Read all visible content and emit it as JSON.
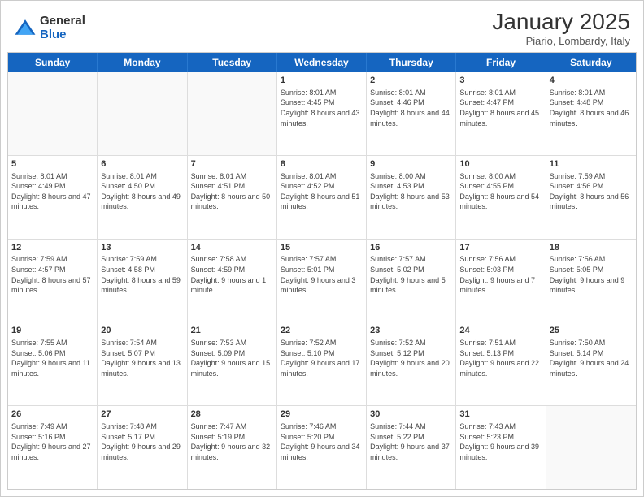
{
  "header": {
    "logo_general": "General",
    "logo_blue": "Blue",
    "month_title": "January 2025",
    "location": "Piario, Lombardy, Italy"
  },
  "day_headers": [
    "Sunday",
    "Monday",
    "Tuesday",
    "Wednesday",
    "Thursday",
    "Friday",
    "Saturday"
  ],
  "weeks": [
    [
      {
        "num": "",
        "sunrise": "",
        "sunset": "",
        "daylight": ""
      },
      {
        "num": "",
        "sunrise": "",
        "sunset": "",
        "daylight": ""
      },
      {
        "num": "",
        "sunrise": "",
        "sunset": "",
        "daylight": ""
      },
      {
        "num": "1",
        "sunrise": "Sunrise: 8:01 AM",
        "sunset": "Sunset: 4:45 PM",
        "daylight": "Daylight: 8 hours and 43 minutes."
      },
      {
        "num": "2",
        "sunrise": "Sunrise: 8:01 AM",
        "sunset": "Sunset: 4:46 PM",
        "daylight": "Daylight: 8 hours and 44 minutes."
      },
      {
        "num": "3",
        "sunrise": "Sunrise: 8:01 AM",
        "sunset": "Sunset: 4:47 PM",
        "daylight": "Daylight: 8 hours and 45 minutes."
      },
      {
        "num": "4",
        "sunrise": "Sunrise: 8:01 AM",
        "sunset": "Sunset: 4:48 PM",
        "daylight": "Daylight: 8 hours and 46 minutes."
      }
    ],
    [
      {
        "num": "5",
        "sunrise": "Sunrise: 8:01 AM",
        "sunset": "Sunset: 4:49 PM",
        "daylight": "Daylight: 8 hours and 47 minutes."
      },
      {
        "num": "6",
        "sunrise": "Sunrise: 8:01 AM",
        "sunset": "Sunset: 4:50 PM",
        "daylight": "Daylight: 8 hours and 49 minutes."
      },
      {
        "num": "7",
        "sunrise": "Sunrise: 8:01 AM",
        "sunset": "Sunset: 4:51 PM",
        "daylight": "Daylight: 8 hours and 50 minutes."
      },
      {
        "num": "8",
        "sunrise": "Sunrise: 8:01 AM",
        "sunset": "Sunset: 4:52 PM",
        "daylight": "Daylight: 8 hours and 51 minutes."
      },
      {
        "num": "9",
        "sunrise": "Sunrise: 8:00 AM",
        "sunset": "Sunset: 4:53 PM",
        "daylight": "Daylight: 8 hours and 53 minutes."
      },
      {
        "num": "10",
        "sunrise": "Sunrise: 8:00 AM",
        "sunset": "Sunset: 4:55 PM",
        "daylight": "Daylight: 8 hours and 54 minutes."
      },
      {
        "num": "11",
        "sunrise": "Sunrise: 7:59 AM",
        "sunset": "Sunset: 4:56 PM",
        "daylight": "Daylight: 8 hours and 56 minutes."
      }
    ],
    [
      {
        "num": "12",
        "sunrise": "Sunrise: 7:59 AM",
        "sunset": "Sunset: 4:57 PM",
        "daylight": "Daylight: 8 hours and 57 minutes."
      },
      {
        "num": "13",
        "sunrise": "Sunrise: 7:59 AM",
        "sunset": "Sunset: 4:58 PM",
        "daylight": "Daylight: 8 hours and 59 minutes."
      },
      {
        "num": "14",
        "sunrise": "Sunrise: 7:58 AM",
        "sunset": "Sunset: 4:59 PM",
        "daylight": "Daylight: 9 hours and 1 minute."
      },
      {
        "num": "15",
        "sunrise": "Sunrise: 7:57 AM",
        "sunset": "Sunset: 5:01 PM",
        "daylight": "Daylight: 9 hours and 3 minutes."
      },
      {
        "num": "16",
        "sunrise": "Sunrise: 7:57 AM",
        "sunset": "Sunset: 5:02 PM",
        "daylight": "Daylight: 9 hours and 5 minutes."
      },
      {
        "num": "17",
        "sunrise": "Sunrise: 7:56 AM",
        "sunset": "Sunset: 5:03 PM",
        "daylight": "Daylight: 9 hours and 7 minutes."
      },
      {
        "num": "18",
        "sunrise": "Sunrise: 7:56 AM",
        "sunset": "Sunset: 5:05 PM",
        "daylight": "Daylight: 9 hours and 9 minutes."
      }
    ],
    [
      {
        "num": "19",
        "sunrise": "Sunrise: 7:55 AM",
        "sunset": "Sunset: 5:06 PM",
        "daylight": "Daylight: 9 hours and 11 minutes."
      },
      {
        "num": "20",
        "sunrise": "Sunrise: 7:54 AM",
        "sunset": "Sunset: 5:07 PM",
        "daylight": "Daylight: 9 hours and 13 minutes."
      },
      {
        "num": "21",
        "sunrise": "Sunrise: 7:53 AM",
        "sunset": "Sunset: 5:09 PM",
        "daylight": "Daylight: 9 hours and 15 minutes."
      },
      {
        "num": "22",
        "sunrise": "Sunrise: 7:52 AM",
        "sunset": "Sunset: 5:10 PM",
        "daylight": "Daylight: 9 hours and 17 minutes."
      },
      {
        "num": "23",
        "sunrise": "Sunrise: 7:52 AM",
        "sunset": "Sunset: 5:12 PM",
        "daylight": "Daylight: 9 hours and 20 minutes."
      },
      {
        "num": "24",
        "sunrise": "Sunrise: 7:51 AM",
        "sunset": "Sunset: 5:13 PM",
        "daylight": "Daylight: 9 hours and 22 minutes."
      },
      {
        "num": "25",
        "sunrise": "Sunrise: 7:50 AM",
        "sunset": "Sunset: 5:14 PM",
        "daylight": "Daylight: 9 hours and 24 minutes."
      }
    ],
    [
      {
        "num": "26",
        "sunrise": "Sunrise: 7:49 AM",
        "sunset": "Sunset: 5:16 PM",
        "daylight": "Daylight: 9 hours and 27 minutes."
      },
      {
        "num": "27",
        "sunrise": "Sunrise: 7:48 AM",
        "sunset": "Sunset: 5:17 PM",
        "daylight": "Daylight: 9 hours and 29 minutes."
      },
      {
        "num": "28",
        "sunrise": "Sunrise: 7:47 AM",
        "sunset": "Sunset: 5:19 PM",
        "daylight": "Daylight: 9 hours and 32 minutes."
      },
      {
        "num": "29",
        "sunrise": "Sunrise: 7:46 AM",
        "sunset": "Sunset: 5:20 PM",
        "daylight": "Daylight: 9 hours and 34 minutes."
      },
      {
        "num": "30",
        "sunrise": "Sunrise: 7:44 AM",
        "sunset": "Sunset: 5:22 PM",
        "daylight": "Daylight: 9 hours and 37 minutes."
      },
      {
        "num": "31",
        "sunrise": "Sunrise: 7:43 AM",
        "sunset": "Sunset: 5:23 PM",
        "daylight": "Daylight: 9 hours and 39 minutes."
      },
      {
        "num": "",
        "sunrise": "",
        "sunset": "",
        "daylight": ""
      }
    ]
  ]
}
